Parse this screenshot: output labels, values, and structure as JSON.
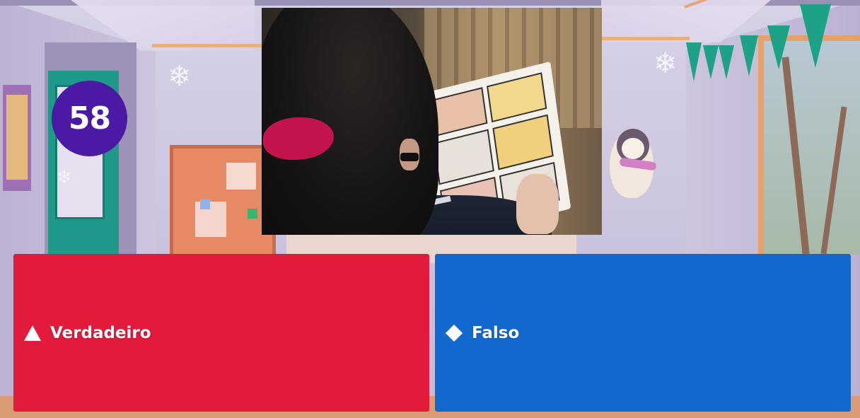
{
  "timer": {
    "value": "58"
  },
  "answers": [
    {
      "shape": "triangle-icon",
      "label": "Verdadeiro",
      "color": "#e21b3c"
    },
    {
      "shape": "diamond-icon",
      "label": "Falso",
      "color": "#1368ce"
    }
  ],
  "colors": {
    "timer_bg": "#4a1aa4",
    "answer_red": "#e21b3c",
    "answer_blue": "#1368ce"
  }
}
